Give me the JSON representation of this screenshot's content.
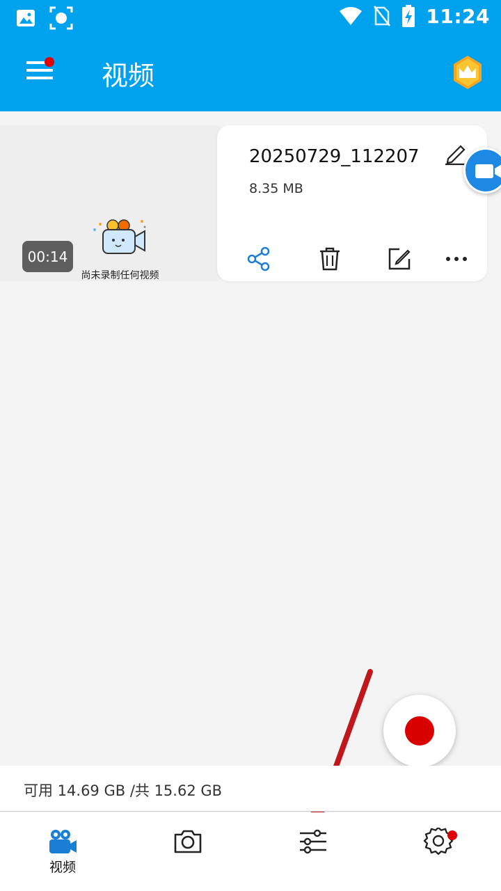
{
  "statusbar": {
    "time": "11:24"
  },
  "appbar": {
    "title": "视频"
  },
  "video": {
    "name": "20250729_112207",
    "size": "8.35 MB",
    "duration": "00:14",
    "thumbnail_caption": "尚未录制任何视频"
  },
  "storage": {
    "text": "可用 14.69 GB /共 15.62 GB"
  },
  "nav": {
    "items": [
      {
        "icon": "video-camera-icon",
        "label": "视频",
        "active": true
      },
      {
        "icon": "camera-icon",
        "label": ""
      },
      {
        "icon": "sliders-icon",
        "label": ""
      },
      {
        "icon": "gear-icon",
        "label": ""
      }
    ]
  },
  "colors": {
    "primary": "#00a2ee",
    "accent": "#1a7fd4",
    "record": "#d90000",
    "badge": "#e00000",
    "annotation_arrow": "#c0171d"
  }
}
